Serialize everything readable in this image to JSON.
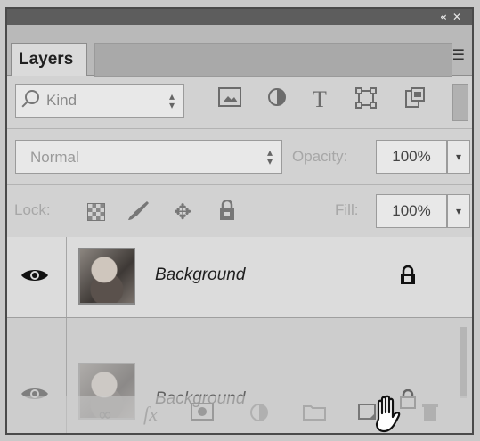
{
  "panel": {
    "title": "Layers",
    "filter": {
      "label": "Kind",
      "icons": [
        "pixel-layer-filter-icon",
        "adjustment-filter-icon",
        "type-filter-icon",
        "shape-filter-icon",
        "smart-object-filter-icon"
      ],
      "type_icon_text": "T"
    },
    "blend_mode": "Normal",
    "opacity_label": "Opacity:",
    "opacity_value": "100%",
    "lock_label": "Lock:",
    "fill_label": "Fill:",
    "fill_value": "100%",
    "collapse_glyph": "«",
    "close_glyph": "✕",
    "menu_glyph": "☰"
  },
  "layers": [
    {
      "name": "Background",
      "visible": true,
      "locked": true,
      "selected": false
    },
    {
      "name": "Background",
      "visible": true,
      "locked": true,
      "ghost": true
    }
  ],
  "bottom_bar": {
    "fx_label": "fx",
    "icons": [
      "link-layers-icon",
      "fx-icon",
      "layer-mask-icon",
      "adjustment-layer-icon",
      "new-group-icon",
      "new-layer-icon",
      "trash-icon"
    ]
  },
  "colors": {
    "panel_bg": "#d2d2d2",
    "topbar": "#5d5d5d",
    "tab_bg": "#dadada"
  }
}
